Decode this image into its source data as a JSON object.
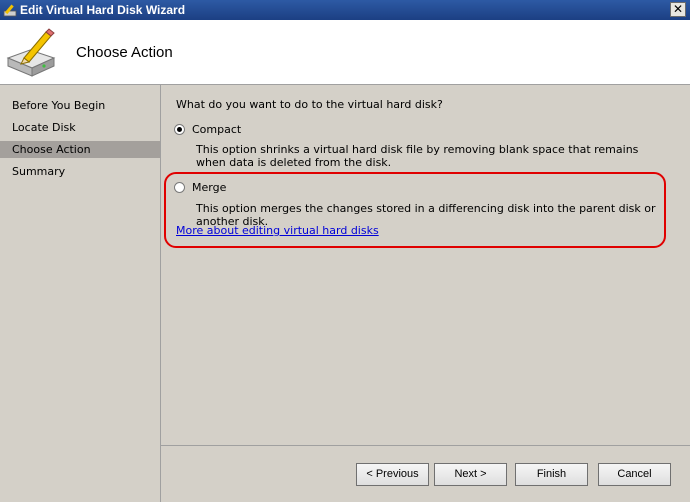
{
  "window": {
    "title": "Edit Virtual Hard Disk Wizard",
    "close": "✕"
  },
  "header": {
    "title": "Choose Action"
  },
  "nav": {
    "items": [
      {
        "label": "Before You Begin"
      },
      {
        "label": "Locate Disk"
      },
      {
        "label": "Choose Action",
        "selected": true
      },
      {
        "label": "Summary"
      }
    ]
  },
  "content": {
    "question": "What do you want to do to the virtual hard disk?",
    "options": [
      {
        "label": "Compact",
        "selected": true,
        "description": "This option shrinks a virtual hard disk file by removing blank space that remains when data is deleted from the disk."
      },
      {
        "label": "Merge",
        "selected": false,
        "description": "This option merges the changes stored in a differencing disk into the parent disk or another disk."
      }
    ],
    "link": "More about editing virtual hard disks"
  },
  "buttons": {
    "previous": "< Previous",
    "next": "Next >",
    "finish": "Finish",
    "cancel": "Cancel"
  },
  "colors": {
    "highlight": "#e00000",
    "link": "#0000d8",
    "titlebar": "#2d5aa4"
  }
}
